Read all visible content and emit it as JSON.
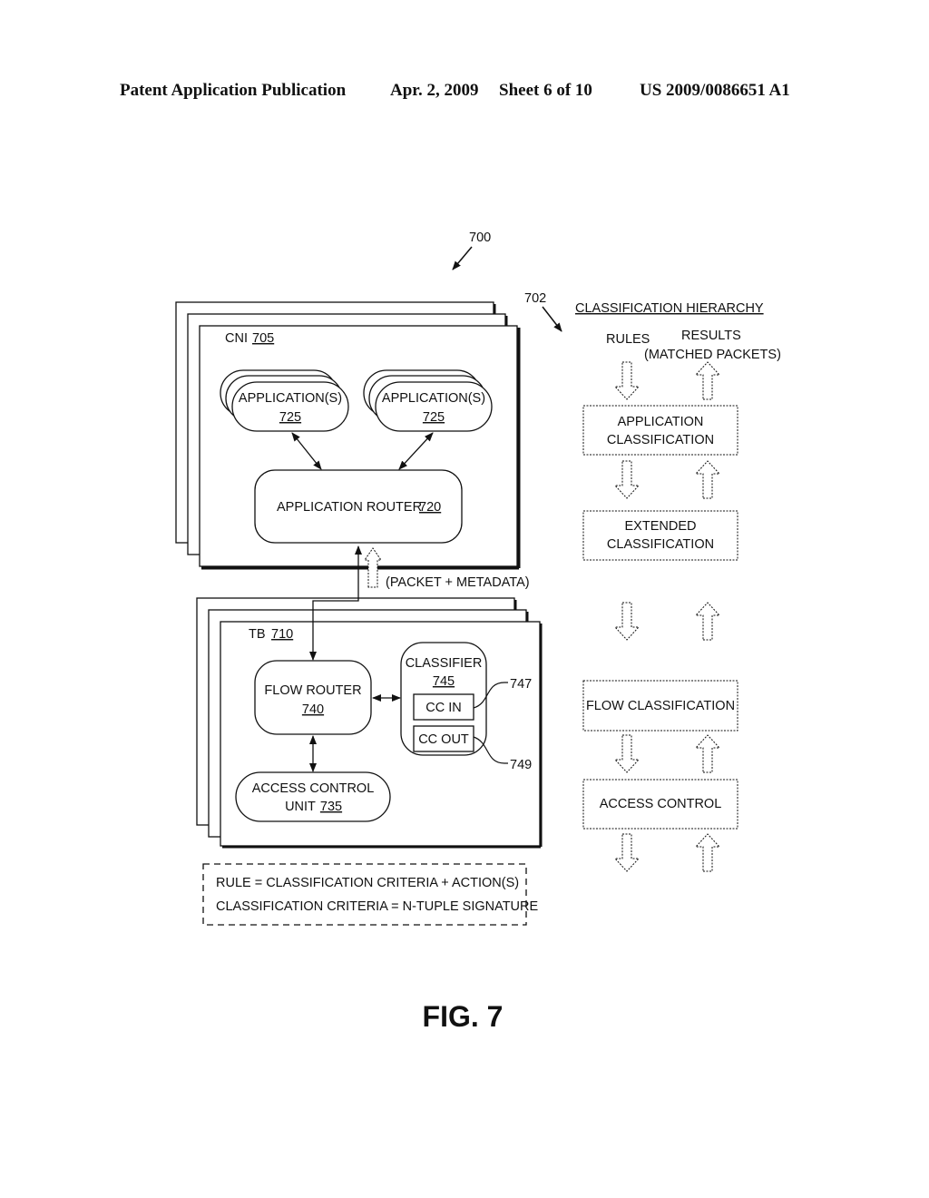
{
  "header": {
    "left": "Patent Application Publication",
    "date": "Apr. 2, 2009",
    "sheet": "Sheet 6 of 10",
    "number": "US 2009/0086651 A1"
  },
  "refs": {
    "figure_ref": "700",
    "hierarchy_ref": "702",
    "cc_in_ref": "747",
    "cc_out_ref": "749"
  },
  "cni": {
    "label": "CNI",
    "num": "705",
    "applications": [
      {
        "label": "APPLICATION(S)",
        "num": "725"
      },
      {
        "label": "APPLICATION(S)",
        "num": "725"
      }
    ],
    "app_router": {
      "label": "APPLICATION ROUTER",
      "num": "720"
    }
  },
  "packet_label": "(PACKET + METADATA)",
  "tb": {
    "label": "TB",
    "num": "710",
    "flow_router": {
      "line1": "FLOW ROUTER",
      "num": "740"
    },
    "classifier": {
      "label": "CLASSIFIER",
      "num": "745",
      "cc_in": "CC IN",
      "cc_out": "CC OUT"
    },
    "access_control": {
      "line1": "ACCESS CONTROL",
      "line2": "UNIT",
      "num": "735"
    }
  },
  "legend": {
    "line1": "RULE = CLASSIFICATION CRITERIA + ACTION(S)",
    "line2": "CLASSIFICATION CRITERIA = N-TUPLE SIGNATURE"
  },
  "hierarchy": {
    "title": "CLASSIFICATION HIERARCHY",
    "rules_label": "RULES",
    "results_label": "RESULTS",
    "results_sub": "(MATCHED PACKETS)",
    "levels": [
      {
        "line1": "APPLICATION",
        "line2": "CLASSIFICATION"
      },
      {
        "line1": "EXTENDED",
        "line2": "CLASSIFICATION"
      },
      {
        "line1": "FLOW CLASSIFICATION",
        "line2": ""
      },
      {
        "line1": "ACCESS CONTROL",
        "line2": ""
      }
    ]
  },
  "figure_caption": "FIG. 7"
}
